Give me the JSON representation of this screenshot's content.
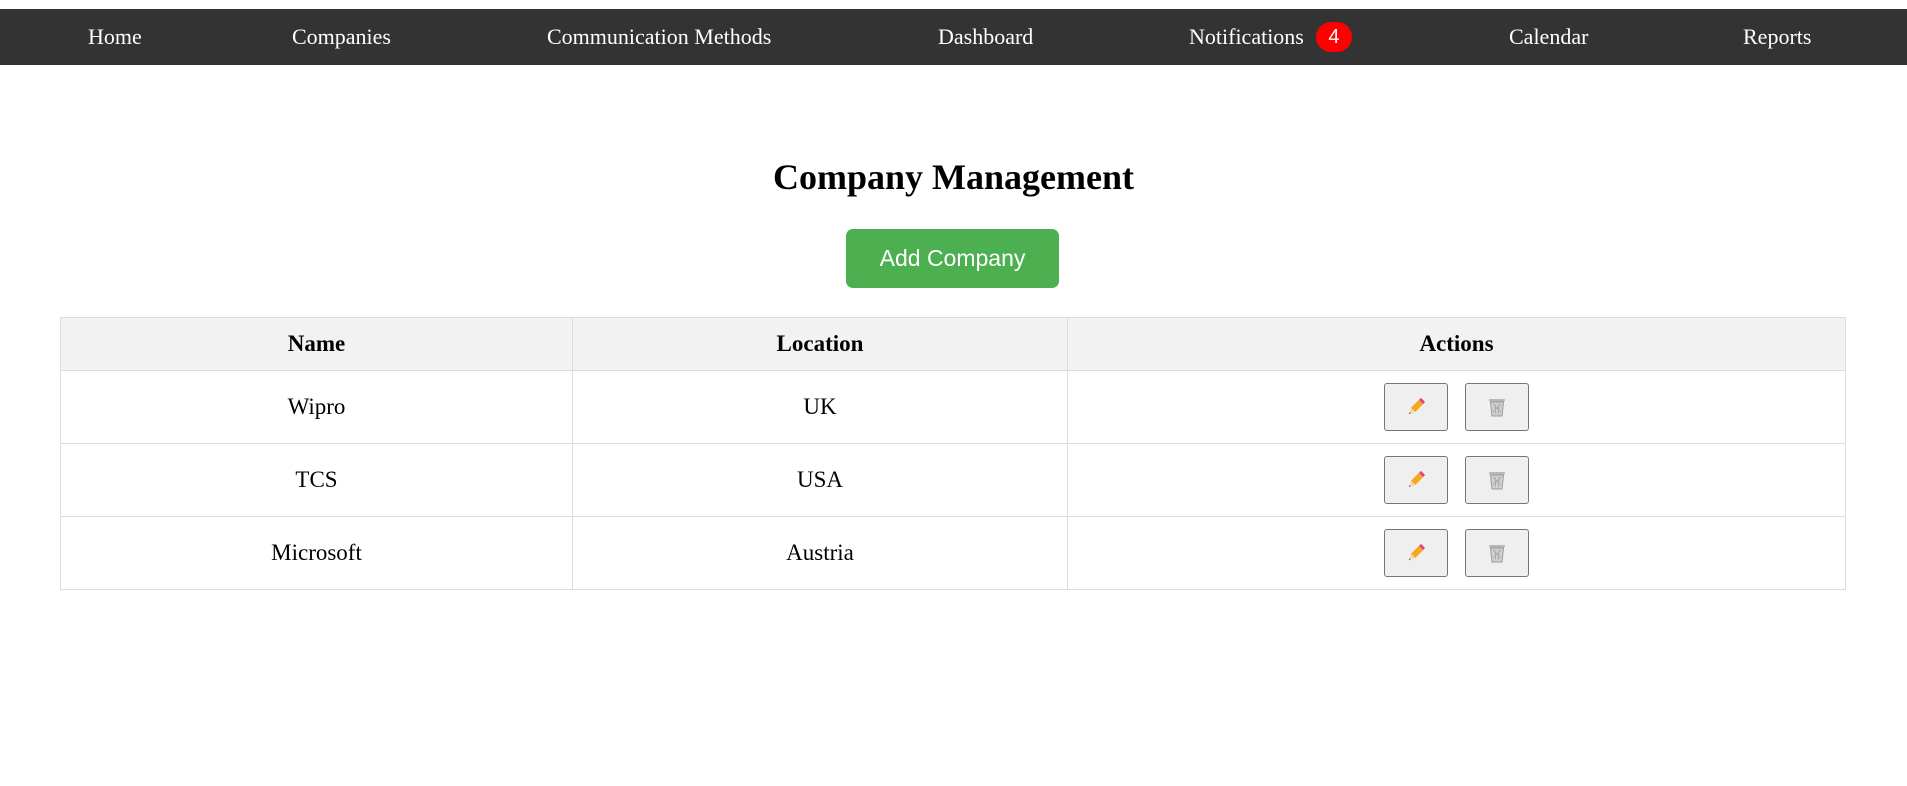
{
  "nav": {
    "items": [
      {
        "label": "Home"
      },
      {
        "label": "Companies"
      },
      {
        "label": "Communication Methods"
      },
      {
        "label": "Dashboard"
      },
      {
        "label": "Notifications",
        "badge": "4"
      },
      {
        "label": "Calendar"
      },
      {
        "label": "Reports"
      }
    ]
  },
  "main": {
    "title": "Company Management",
    "add_button_label": "Add Company"
  },
  "table": {
    "headers": [
      "Name",
      "Location",
      "Actions"
    ],
    "rows": [
      {
        "name": "Wipro",
        "location": "UK"
      },
      {
        "name": "TCS",
        "location": "USA"
      },
      {
        "name": "Microsoft",
        "location": "Austria"
      }
    ],
    "actions": {
      "edit_icon": "pencil-icon",
      "delete_icon": "wastebasket-icon"
    }
  },
  "colors": {
    "navbar_bg": "#333333",
    "badge_bg": "#ff0000",
    "add_button_bg": "#4caf50",
    "header_bg": "#f2f2f2"
  }
}
